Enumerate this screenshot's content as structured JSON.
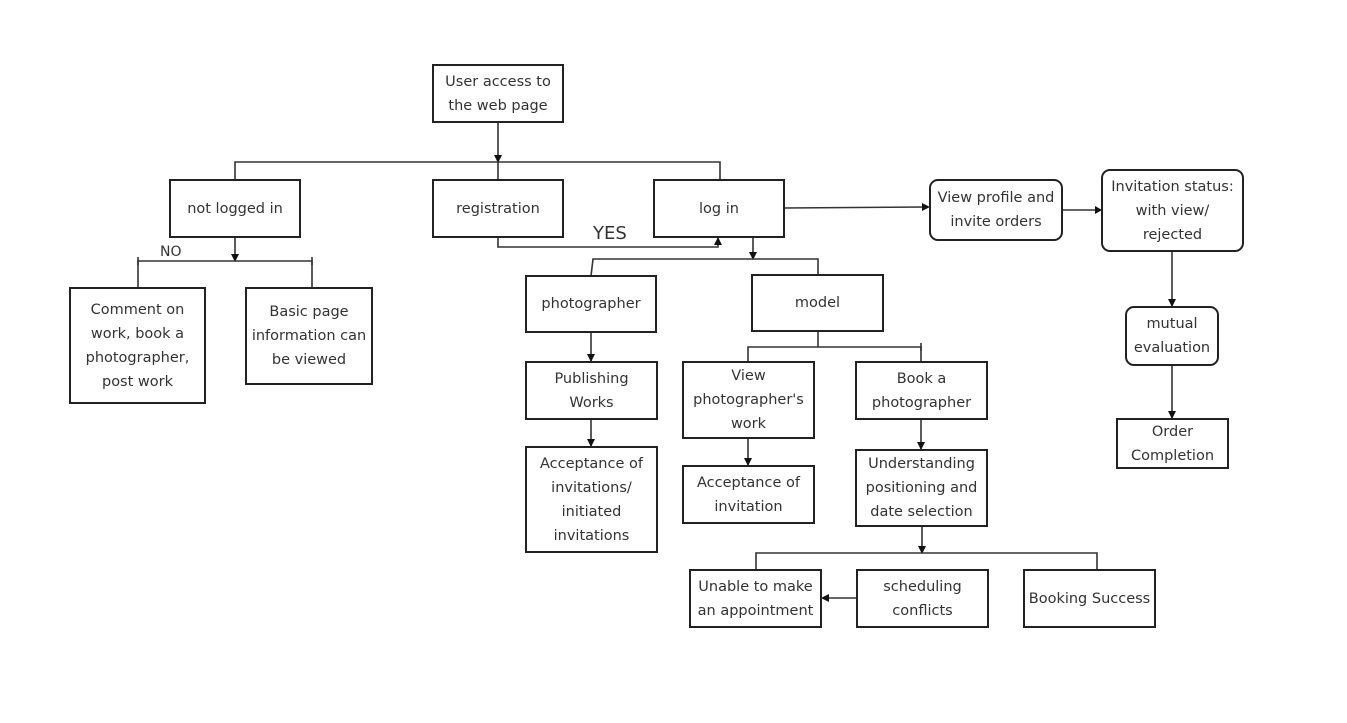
{
  "diagram": {
    "type": "flowchart",
    "nodes": {
      "user_access": "User access to\nthe web page",
      "not_logged_in": "not logged in",
      "registration": "registration",
      "log_in": "log in",
      "view_profile": "View profile and\ninvite orders",
      "invitation_status": "Invitation status:\nwith view/\nrejected",
      "comment_on_work": "Comment on\nwork, book a\nphotographer,\npost work",
      "basic_page_info": "Basic page\ninformation can\nbe viewed",
      "photographer": "photographer",
      "model": "model",
      "mutual_evaluation": "mutual\nevaluation",
      "publishing_works": "Publishing\nWorks",
      "view_photographer_work": "View\nphotographer's\nwork",
      "book_photographer": "Book a\nphotographer",
      "order_completion": "Order\nCompletion",
      "acceptance_invitations": "Acceptance of\ninvitations/\ninitiated\ninvitations",
      "acceptance_invitation": "Acceptance of\ninvitation",
      "understanding_positioning": "Understanding\npositioning and\ndate selection",
      "unable_appointment": "Unable to make\nan appointment",
      "scheduling_conflicts": "scheduling\nconflicts",
      "booking_success": "Booking Success"
    },
    "edge_labels": {
      "yes": "YES",
      "no": "NO"
    },
    "edges": [
      {
        "from": "user_access",
        "to": [
          "not_logged_in",
          "registration",
          "log_in"
        ]
      },
      {
        "from": "not_logged_in",
        "to": [
          "comment_on_work",
          "basic_page_info"
        ],
        "label": "NO"
      },
      {
        "from": "registration",
        "to": "log_in",
        "label": "YES"
      },
      {
        "from": "log_in",
        "to": [
          "photographer",
          "model"
        ]
      },
      {
        "from": "log_in",
        "to": "view_profile"
      },
      {
        "from": "view_profile",
        "to": "invitation_status"
      },
      {
        "from": "invitation_status",
        "to": "mutual_evaluation"
      },
      {
        "from": "mutual_evaluation",
        "to": "order_completion"
      },
      {
        "from": "photographer",
        "to": "publishing_works"
      },
      {
        "from": "publishing_works",
        "to": "acceptance_invitations"
      },
      {
        "from": "model",
        "to": [
          "view_photographer_work",
          "book_photographer"
        ]
      },
      {
        "from": "view_photographer_work",
        "to": "acceptance_invitation"
      },
      {
        "from": "book_photographer",
        "to": "understanding_positioning"
      },
      {
        "from": "understanding_positioning",
        "to": [
          "unable_appointment",
          "scheduling_conflicts",
          "booking_success"
        ]
      },
      {
        "from": "scheduling_conflicts",
        "to": "unable_appointment"
      }
    ]
  }
}
